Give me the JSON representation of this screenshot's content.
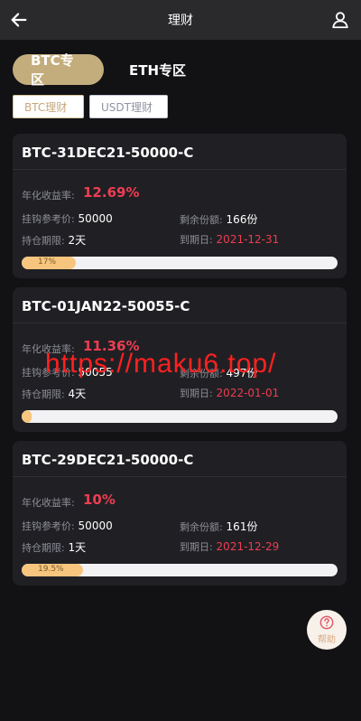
{
  "header": {
    "title": "理财",
    "back_icon": "arrow-left-icon",
    "user_icon": "user-icon"
  },
  "zones": [
    {
      "label": "BTC专区",
      "active": true
    },
    {
      "label": "ETH专区",
      "active": false
    }
  ],
  "sub_tabs": [
    {
      "label": "BTC理财",
      "active": true
    },
    {
      "label": "USDT理财",
      "active": false
    }
  ],
  "labels": {
    "rate": "年化收益率:",
    "ref_price": "挂钩参考价:",
    "remaining": "剩余份额:",
    "holding": "持仓期限:",
    "expiry": "到期日:"
  },
  "products": [
    {
      "name": "BTC-31DEC21-50000-C",
      "rate": "12.69%",
      "ref_price": "50000",
      "remaining": "166份",
      "holding": "2天",
      "expiry": "2021-12-31",
      "progress_text": "17%",
      "progress": 0.17
    },
    {
      "name": "BTC-01JAN22-50055-C",
      "rate": "11.36%",
      "ref_price": "50055",
      "remaining": "497份",
      "holding": "4天",
      "expiry": "2022-01-01",
      "progress_text": "",
      "progress": 0.01
    },
    {
      "name": "BTC-29DEC21-50000-C",
      "rate": "10%",
      "ref_price": "50000",
      "remaining": "161份",
      "holding": "1天",
      "expiry": "2021-12-29",
      "progress_text": "19.5%",
      "progress": 0.195
    }
  ],
  "help": {
    "label": "帮助",
    "icon": "question-icon"
  },
  "watermark": "https://maku6.top/",
  "colors": {
    "accent": "#c4ad7c",
    "red": "#ee3d52",
    "progress_fill": "#f7c57e"
  }
}
